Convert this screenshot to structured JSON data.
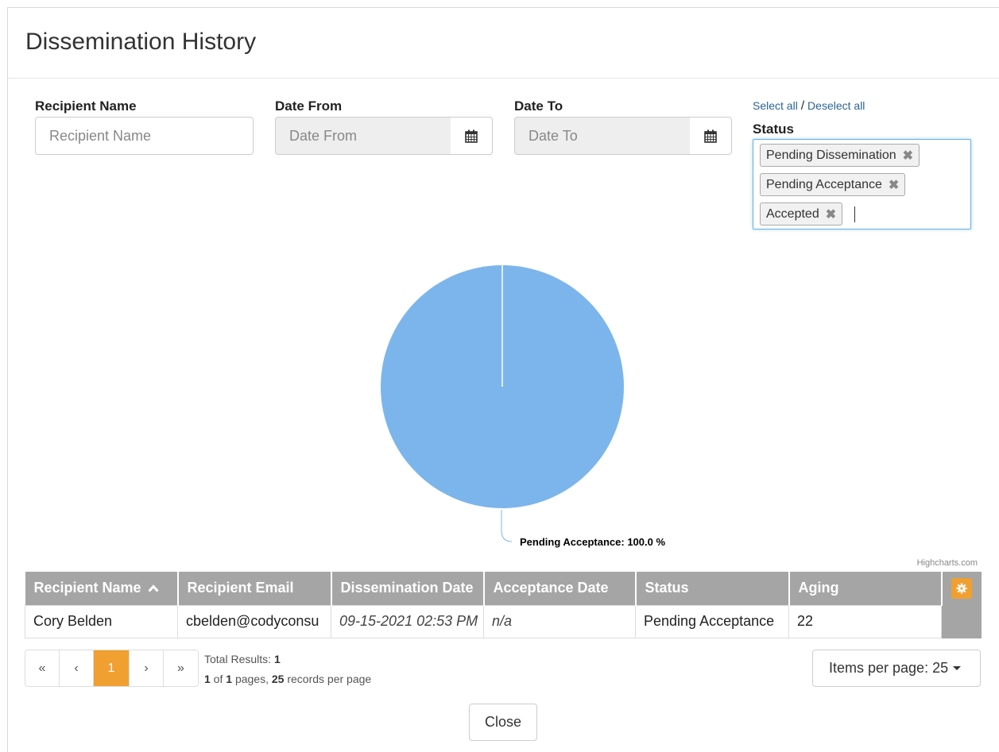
{
  "dialog": {
    "title": "Dissemination History"
  },
  "filters": {
    "recipient_name": {
      "label": "Recipient Name",
      "placeholder": "Recipient Name",
      "value": ""
    },
    "date_from": {
      "label": "Date From",
      "placeholder": "Date From",
      "value": "",
      "icon": "calendar-icon"
    },
    "date_to": {
      "label": "Date To",
      "placeholder": "Date To",
      "value": "",
      "icon": "calendar-icon"
    },
    "select_all": "Select all",
    "separator": "/",
    "deselect_all": "Deselect all",
    "status": {
      "label": "Status",
      "selected": [
        "Pending Dissemination",
        "Pending Acceptance",
        "Accepted"
      ],
      "remove_glyph": "✖"
    }
  },
  "chart_data": {
    "type": "pie",
    "slices": [
      {
        "label": "Pending Acceptance",
        "value": 100.0,
        "color": "#7cb5ec"
      }
    ],
    "data_labels": [
      "Pending Acceptance: 100.0 %"
    ],
    "credits": "Highcharts.com"
  },
  "table": {
    "columns": [
      "Recipient Name",
      "Recipient Email",
      "Dissemination Date",
      "Acceptance Date",
      "Status",
      "Aging"
    ],
    "sort_indicator": "chevron-up-icon",
    "rows": [
      {
        "recipient_name": "Cory Belden",
        "recipient_email": "cbelden@codyconsu",
        "dissemination_date": "09-15-2021 02:53 PM",
        "acceptance_date": "n/a",
        "status": "Pending Acceptance",
        "aging": "22"
      }
    ],
    "settings_icon": "gear-icon"
  },
  "pagination": {
    "first": "«",
    "prev": "‹",
    "current": "1",
    "next": "›",
    "last": "»",
    "total_results_label": "Total Results: ",
    "total_results": "1",
    "page_current": "1",
    "of_label": " of ",
    "page_total": "1",
    "pages_label": " pages, ",
    "records_per_page": "25",
    "records_label": " records per page"
  },
  "items_per_page": {
    "label": "Items per page: 25"
  },
  "footer": {
    "close_label": "Close"
  },
  "colors": {
    "accent": "#f0a030",
    "header_gray": "#a5a5a5",
    "pie_blue": "#7cb5ec",
    "link": "#2a6496"
  }
}
